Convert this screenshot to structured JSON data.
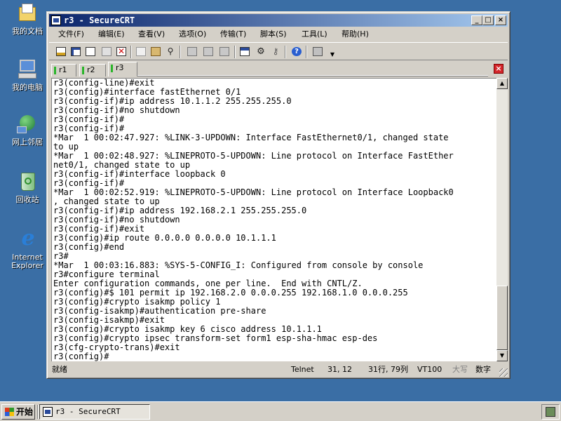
{
  "desktop": {
    "icons": [
      {
        "label": "我的文档",
        "icon": "my-documents-icon"
      },
      {
        "label": "我的电脑",
        "icon": "my-computer-icon"
      },
      {
        "label": "网上邻居",
        "icon": "network-places-icon"
      },
      {
        "label": "回收站",
        "icon": "recycle-bin-icon"
      },
      {
        "label": "Internet Explorer",
        "icon": "internet-explorer-icon"
      }
    ]
  },
  "window": {
    "title": "r3 - SecureCRT",
    "controls": {
      "minimize": "_",
      "maximize": "□",
      "close": "×"
    },
    "menu": [
      {
        "label": "文件(F)"
      },
      {
        "label": "编辑(E)"
      },
      {
        "label": "查看(V)"
      },
      {
        "label": "选项(O)"
      },
      {
        "label": "传输(T)"
      },
      {
        "label": "脚本(S)"
      },
      {
        "label": "工具(L)"
      },
      {
        "label": "帮助(H)"
      }
    ],
    "toolbar_icons": [
      "connect-icon",
      "quick-connect-icon",
      "connect-in-tab-icon",
      "reconnect-icon",
      "disconnect-icon",
      "copy-icon",
      "paste-icon",
      "find-icon",
      "print-icon",
      "print-selection-icon",
      "print-setup-icon",
      "session-options-icon",
      "global-options-icon",
      "keymap-icon",
      "help-icon",
      "sftp-icon"
    ],
    "tabs": [
      {
        "label": "r1",
        "active": false
      },
      {
        "label": "r2",
        "active": false
      },
      {
        "label": "r3",
        "active": true
      }
    ],
    "tab_close": "×",
    "terminal_lines": [
      "r3(config-line)#exit",
      "r3(config)#interface fastEthernet 0/1",
      "r3(config-if)#ip address 10.1.1.2 255.255.255.0",
      "r3(config-if)#no shutdown",
      "r3(config-if)#",
      "r3(config-if)#",
      "*Mar  1 00:02:47.927: %LINK-3-UPDOWN: Interface FastEthernet0/1, changed state",
      "to up",
      "*Mar  1 00:02:48.927: %LINEPROTO-5-UPDOWN: Line protocol on Interface FastEther",
      "net0/1, changed state to up",
      "r3(config-if)#interface loopback 0",
      "r3(config-if)#",
      "*Mar  1 00:02:52.919: %LINEPROTO-5-UPDOWN: Line protocol on Interface Loopback0",
      ", changed state to up",
      "r3(config-if)#ip address 192.168.2.1 255.255.255.0",
      "r3(config-if)#no shutdown",
      "r3(config-if)#exit",
      "r3(config)#ip route 0.0.0.0 0.0.0.0 10.1.1.1",
      "r3(config)#end",
      "r3#",
      "*Mar  1 00:03:16.883: %SYS-5-CONFIG_I: Configured from console by console",
      "r3#configure terminal",
      "Enter configuration commands, one per line.  End with CNTL/Z.",
      "r3(config)#$ 101 permit ip 192.168.2.0 0.0.0.255 192.168.1.0 0.0.0.255",
      "r3(config)#crypto isakmp policy 1",
      "r3(config-isakmp)#authentication pre-share",
      "r3(config-isakmp)#exit",
      "r3(config)#crypto isakmp key 6 cisco address 10.1.1.1",
      "r3(config)#crypto ipsec transform-set form1 esp-sha-hmac esp-des",
      "r3(cfg-crypto-trans)#exit",
      "r3(config)#"
    ],
    "status": {
      "ready": "就绪",
      "protocol": "Telnet",
      "cursor": "31,  12",
      "size": "31行, 79列",
      "emulation": "VT100",
      "caps": "大写",
      "num": "数字"
    }
  },
  "taskbar": {
    "start_label": "开始",
    "task_label": "r3 - SecureCRT"
  }
}
